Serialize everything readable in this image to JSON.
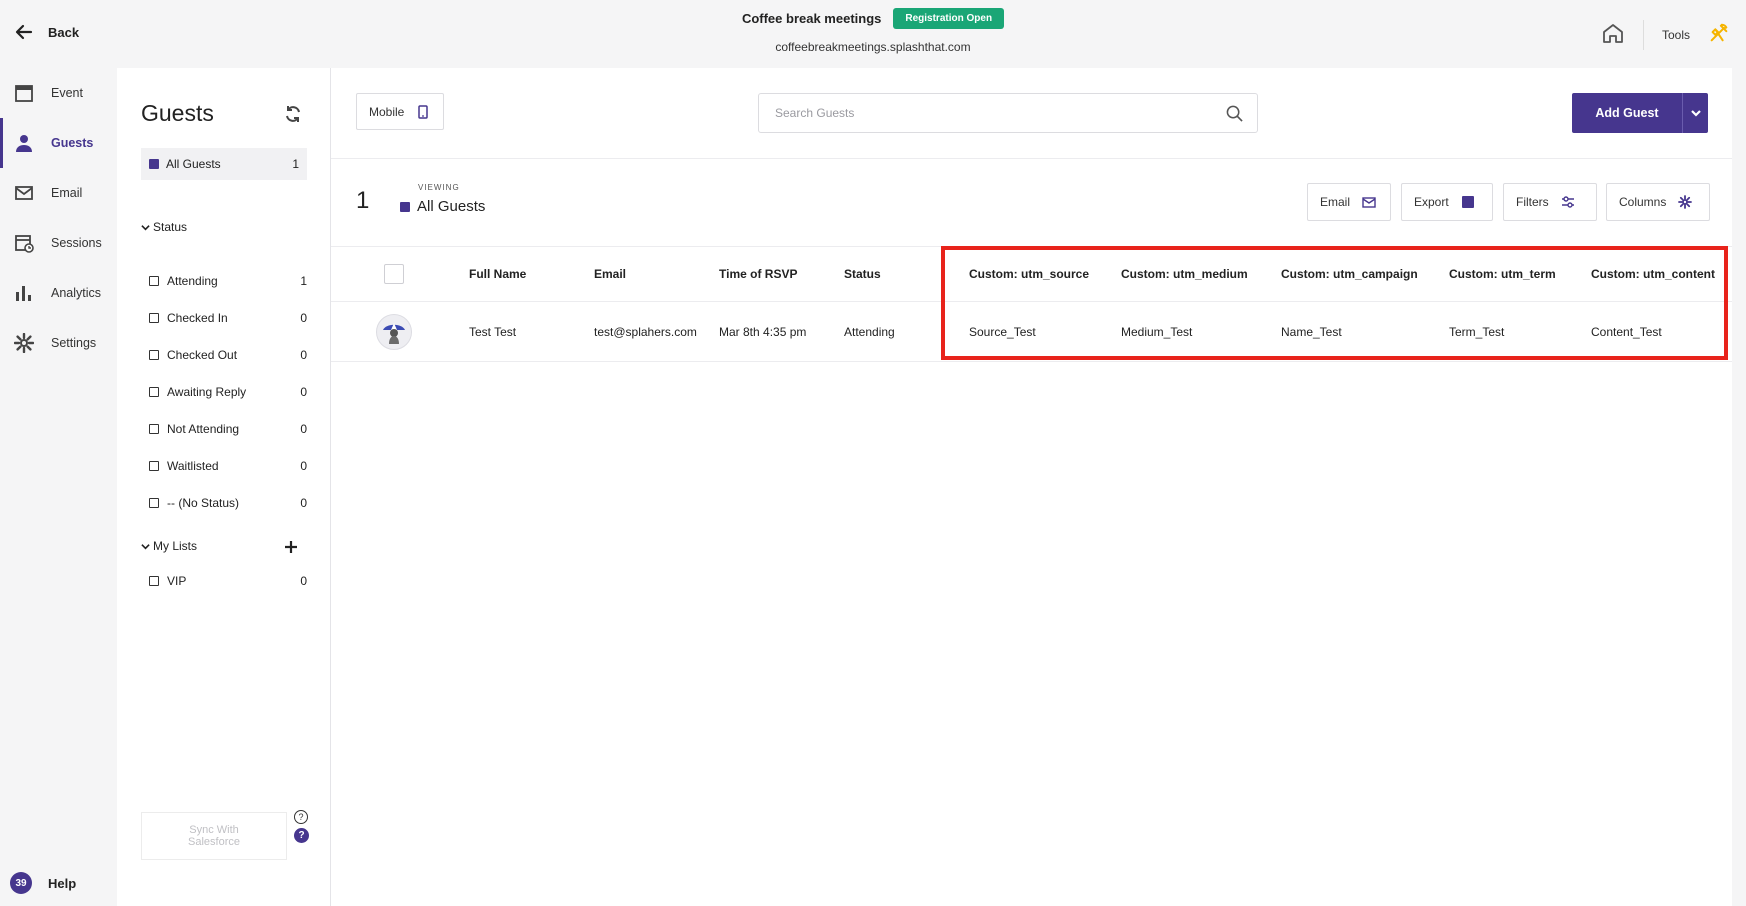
{
  "header": {
    "back_label": "Back",
    "event_title": "Coffee break meetings",
    "registration_badge": "Registration Open",
    "event_url": "coffeebreakmeetings.splashthat.com",
    "tools_label": "Tools"
  },
  "leftnav": {
    "items": [
      {
        "label": "Event",
        "icon": "calendar-icon"
      },
      {
        "label": "Guests",
        "icon": "person-icon"
      },
      {
        "label": "Email",
        "icon": "envelope-icon"
      },
      {
        "label": "Sessions",
        "icon": "sessions-icon"
      },
      {
        "label": "Analytics",
        "icon": "bar-chart-icon"
      },
      {
        "label": "Settings",
        "icon": "gear-icon"
      }
    ],
    "active": "Guests",
    "help_badge": "39",
    "help_label": "Help"
  },
  "guests_sidebar": {
    "title": "Guests",
    "all_guests": {
      "label": "All Guests",
      "count": "1"
    },
    "status_heading": "Status",
    "statuses": [
      {
        "label": "Attending",
        "count": "1"
      },
      {
        "label": "Checked In",
        "count": "0"
      },
      {
        "label": "Checked Out",
        "count": "0"
      },
      {
        "label": "Awaiting Reply",
        "count": "0"
      },
      {
        "label": "Not Attending",
        "count": "0"
      },
      {
        "label": "Waitlisted",
        "count": "0"
      },
      {
        "label": "-- (No Status)",
        "count": "0"
      }
    ],
    "lists_heading": "My Lists",
    "lists": [
      {
        "label": "VIP",
        "count": "0"
      }
    ],
    "sync_label": "Sync With Salesforce",
    "help_q": "?"
  },
  "toolbar": {
    "mobile_label": "Mobile",
    "search_placeholder": "Search Guests",
    "add_guest_label": "Add Guest"
  },
  "viewing": {
    "count": "1",
    "label": "VIEWING",
    "value": "All Guests"
  },
  "actions": {
    "email": "Email",
    "export": "Export",
    "filters": "Filters",
    "columns": "Columns"
  },
  "table": {
    "headers": {
      "full_name": "Full Name",
      "email": "Email",
      "time_of_rsvp": "Time of RSVP",
      "status": "Status",
      "utm_source": "Custom: utm_source",
      "utm_medium": "Custom: utm_medium",
      "utm_campaign": "Custom: utm_campaign",
      "utm_term": "Custom: utm_term",
      "utm_content": "Custom: utm_content"
    },
    "rows": [
      {
        "full_name": "Test Test",
        "email": "test@splahers.com",
        "time_of_rsvp": "Mar 8th 4:35 pm",
        "status": "Attending",
        "utm_source": "Source_Test",
        "utm_medium": "Medium_Test",
        "utm_campaign": "Name_Test",
        "utm_term": "Term_Test",
        "utm_content": "Content_Test"
      }
    ]
  },
  "colors": {
    "brand": "#46368e",
    "registration_badge": "#1aa676",
    "highlight": "#e8231b",
    "tools_accent": "#f5b400"
  }
}
